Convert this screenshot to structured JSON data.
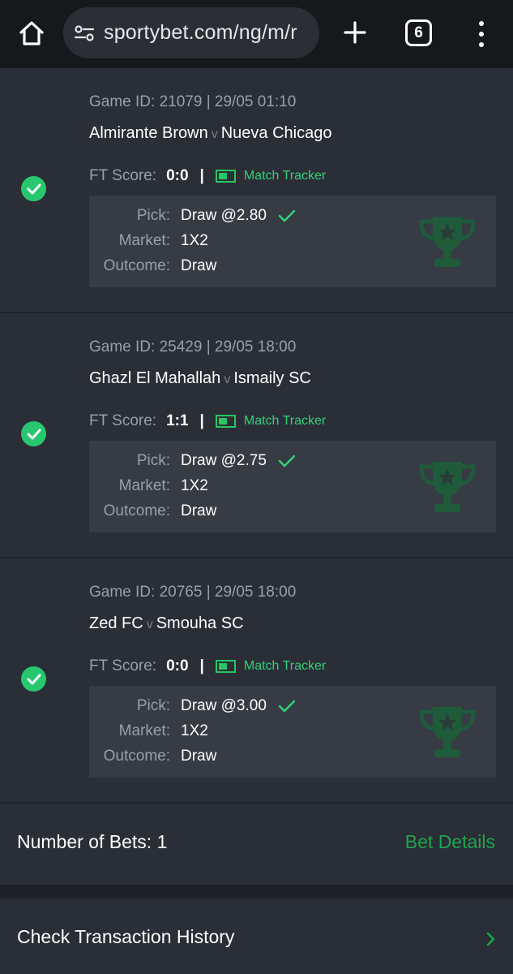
{
  "browser": {
    "url": "sportybet.com/ng/m/r",
    "tab_count": "6"
  },
  "bets": [
    {
      "game_id": "Game ID: 21079 | 29/05 01:10",
      "home": "Almirante Brown",
      "vs": "v",
      "away": "Nueva Chicago",
      "score_label": "FT Score:",
      "score": "0:0",
      "divider": "|",
      "tracker": "Match Tracker",
      "pick_label": "Pick:",
      "pick": "Draw @2.80",
      "market_label": "Market:",
      "market": "1X2",
      "outcome_label": "Outcome:",
      "outcome": "Draw"
    },
    {
      "game_id": "Game ID: 25429 | 29/05 18:00",
      "home": "Ghazl El Mahallah",
      "vs": "v",
      "away": "Ismaily SC",
      "score_label": "FT Score:",
      "score": "1:1",
      "divider": "|",
      "tracker": "Match Tracker",
      "pick_label": "Pick:",
      "pick": "Draw @2.75",
      "market_label": "Market:",
      "market": "1X2",
      "outcome_label": "Outcome:",
      "outcome": "Draw"
    },
    {
      "game_id": "Game ID: 20765 | 29/05 18:00",
      "home": "Zed FC",
      "vs": "v",
      "away": "Smouha SC",
      "score_label": "FT Score:",
      "score": "0:0",
      "divider": "|",
      "tracker": "Match Tracker",
      "pick_label": "Pick:",
      "pick": "Draw @3.00",
      "market_label": "Market:",
      "market": "1X2",
      "outcome_label": "Outcome:",
      "outcome": "Draw"
    }
  ],
  "summary": {
    "bets_count": "Number of Bets: 1",
    "bet_details": "Bet Details"
  },
  "history": {
    "label": "Check Transaction History"
  },
  "colors": {
    "accent_green": "#28c76f",
    "link_green": "#1fa44f",
    "background": "#2a2e36",
    "pick_box": "#363b44"
  },
  "icons": [
    "home-icon",
    "site-settings-icon",
    "plus-icon",
    "tabs-icon",
    "more-vert-icon",
    "check-circle-icon",
    "match-tracker-icon",
    "checkmark-icon",
    "trophy-icon",
    "chevron-right-icon"
  ]
}
